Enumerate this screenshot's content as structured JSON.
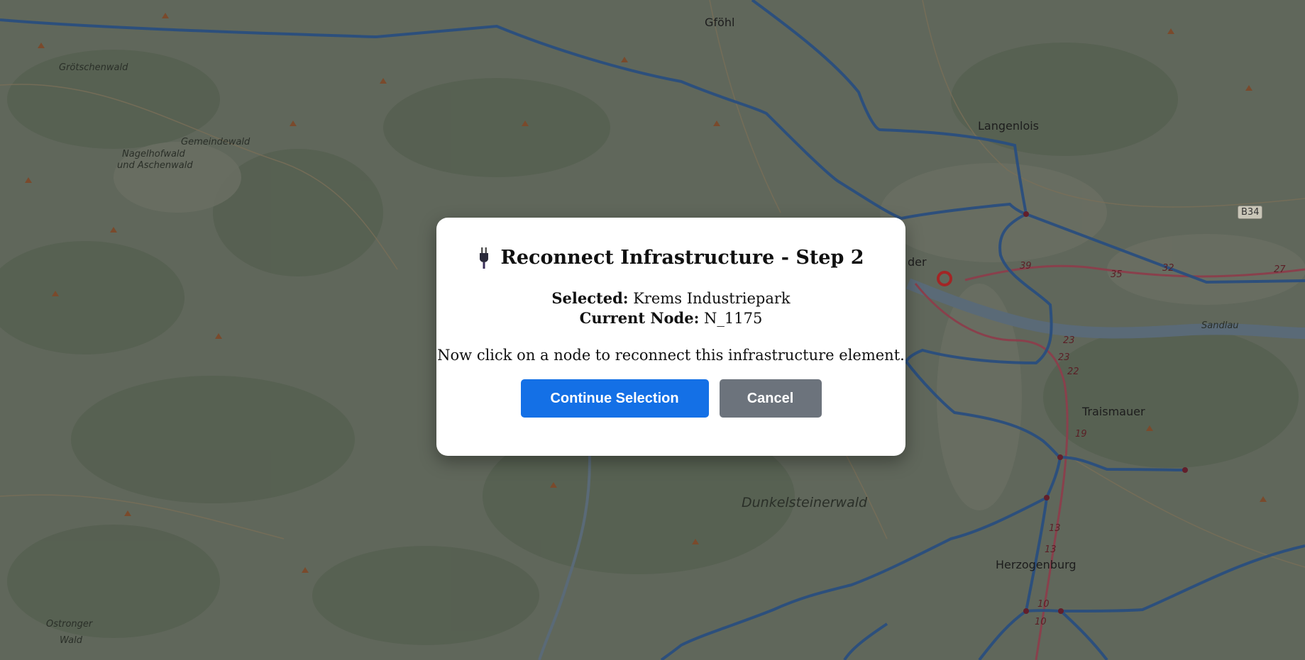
{
  "dialog": {
    "title": "Reconnect Infrastructure - Step 2",
    "title_icon": "plug-icon",
    "selected_label": "Selected:",
    "selected_value": "Krems Industriepark",
    "node_label": "Current Node:",
    "node_value": "N_1175",
    "instruction": "Now click on a node to reconnect this infrastructure element.",
    "continue_label": "Continue Selection",
    "cancel_label": "Cancel"
  },
  "map": {
    "towns": {
      "gfohl": "Gföhl",
      "langenlois": "Langenlois",
      "traismauer": "Traismauer",
      "herzogenburg": "Herzogenburg",
      "krems_partial": "der"
    },
    "forests": {
      "grotschenwald": "Grötschenwald",
      "gemeindewald": "Gemeindewald",
      "nagelhofwald_1": "Nagelhofwald",
      "nagelhofwald_2": "und Aschenwald",
      "dunkelsteinerwald": "Dunkelsteinerwald",
      "sandlau": "Sandlau",
      "ostronger_1": "Ostronger",
      "ostronger_2": "Wald"
    },
    "road_shield": "B34",
    "route_numbers": {
      "r39": "39",
      "r35": "35",
      "r32": "32",
      "r27": "27",
      "r23a": "23",
      "r23b": "23",
      "r22": "22",
      "r19": "19",
      "r13a": "13",
      "r13b": "13",
      "r10a": "10",
      "r10b": "10"
    },
    "colors": {
      "pipeline": "#1f4f8f",
      "highlight_node": "#c01818",
      "overlay_tint": "#5f6660"
    }
  }
}
